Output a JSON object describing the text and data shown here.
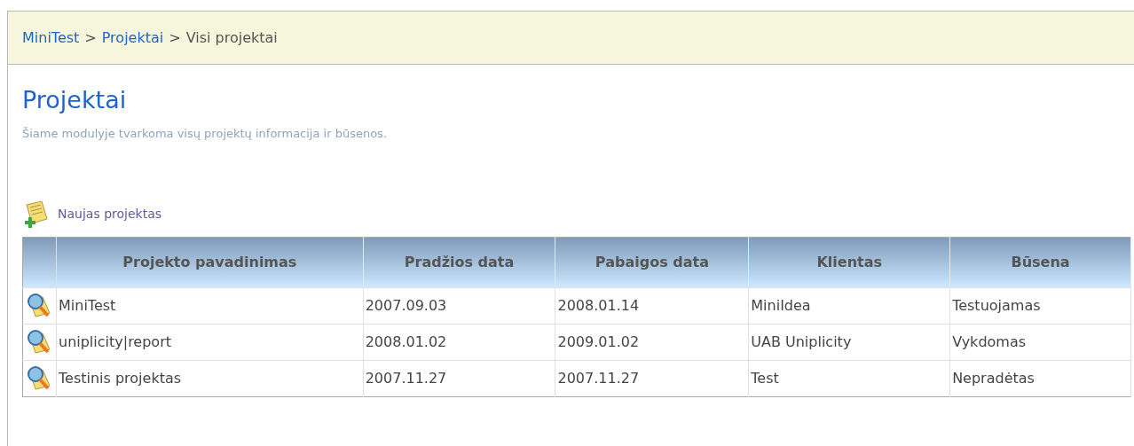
{
  "breadcrumb": [
    {
      "label": "MiniTest",
      "kind": "link"
    },
    {
      "label": "Projektai",
      "kind": "link"
    },
    {
      "label": "Visi projektai",
      "kind": "current"
    }
  ],
  "breadcrumb_separator": ">",
  "title": "Projektai",
  "description": "Šiame modulyje tvarkoma visų projektų informacija ir būsenos.",
  "new_project_link": "Naujas projektas",
  "table": {
    "columns": [
      "Projekto pavadinimas",
      "Pradžios data",
      "Pabaigos data",
      "Klientas",
      "Būsena"
    ],
    "rows": [
      {
        "cells": [
          "MiniTest",
          "2007.09.03",
          "2008.01.14",
          "MiniIdea",
          "Testuojamas"
        ]
      },
      {
        "cells": [
          "uniplicity|report",
          "2008.01.02",
          "2009.01.02",
          "UAB Uniplicity",
          "Vykdomas"
        ]
      },
      {
        "cells": [
          "Testinis projektas",
          "2007.11.27",
          "2007.11.27",
          "Test",
          "Nepradėtas"
        ]
      }
    ]
  }
}
